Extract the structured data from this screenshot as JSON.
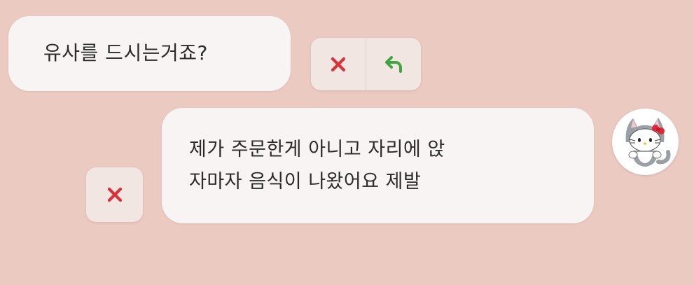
{
  "chat": {
    "messages": [
      {
        "text": "유사를 드시는거죠?"
      },
      {
        "lines": [
          "제가 주문한게 아니고 자리에 앉",
          "자마자 음식이 나왔어요 제발"
        ]
      }
    ]
  },
  "icons": {
    "delete": "close-icon",
    "resend": "undo-arrow-icon",
    "avatar": "hello-kitty-cat-costume-avatar"
  },
  "colors": {
    "background": "#ebcac2",
    "bubble": "#f8f4f3",
    "delete_red": "#d8323a",
    "resend_green": "#3fa541"
  }
}
